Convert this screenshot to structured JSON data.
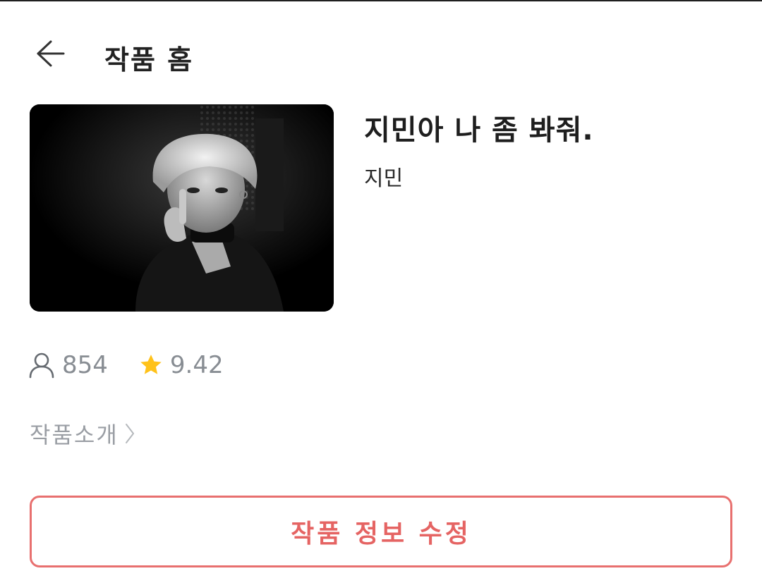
{
  "header": {
    "back_icon": "arrow-left-icon",
    "title": "작품 홈"
  },
  "work": {
    "title": "지민아 나 좀 봐줘.",
    "author": "지민",
    "cover_icon": "cover-image"
  },
  "stats": {
    "views_icon": "person-icon",
    "views": "854",
    "rating_icon": "star-icon",
    "rating": "9.42",
    "star_color": "#FFC21A"
  },
  "intro": {
    "label": "작품소개",
    "icon": "chevron-right-icon"
  },
  "edit_button": {
    "label": "작품 정보 수정",
    "accent": "#E8706F"
  }
}
